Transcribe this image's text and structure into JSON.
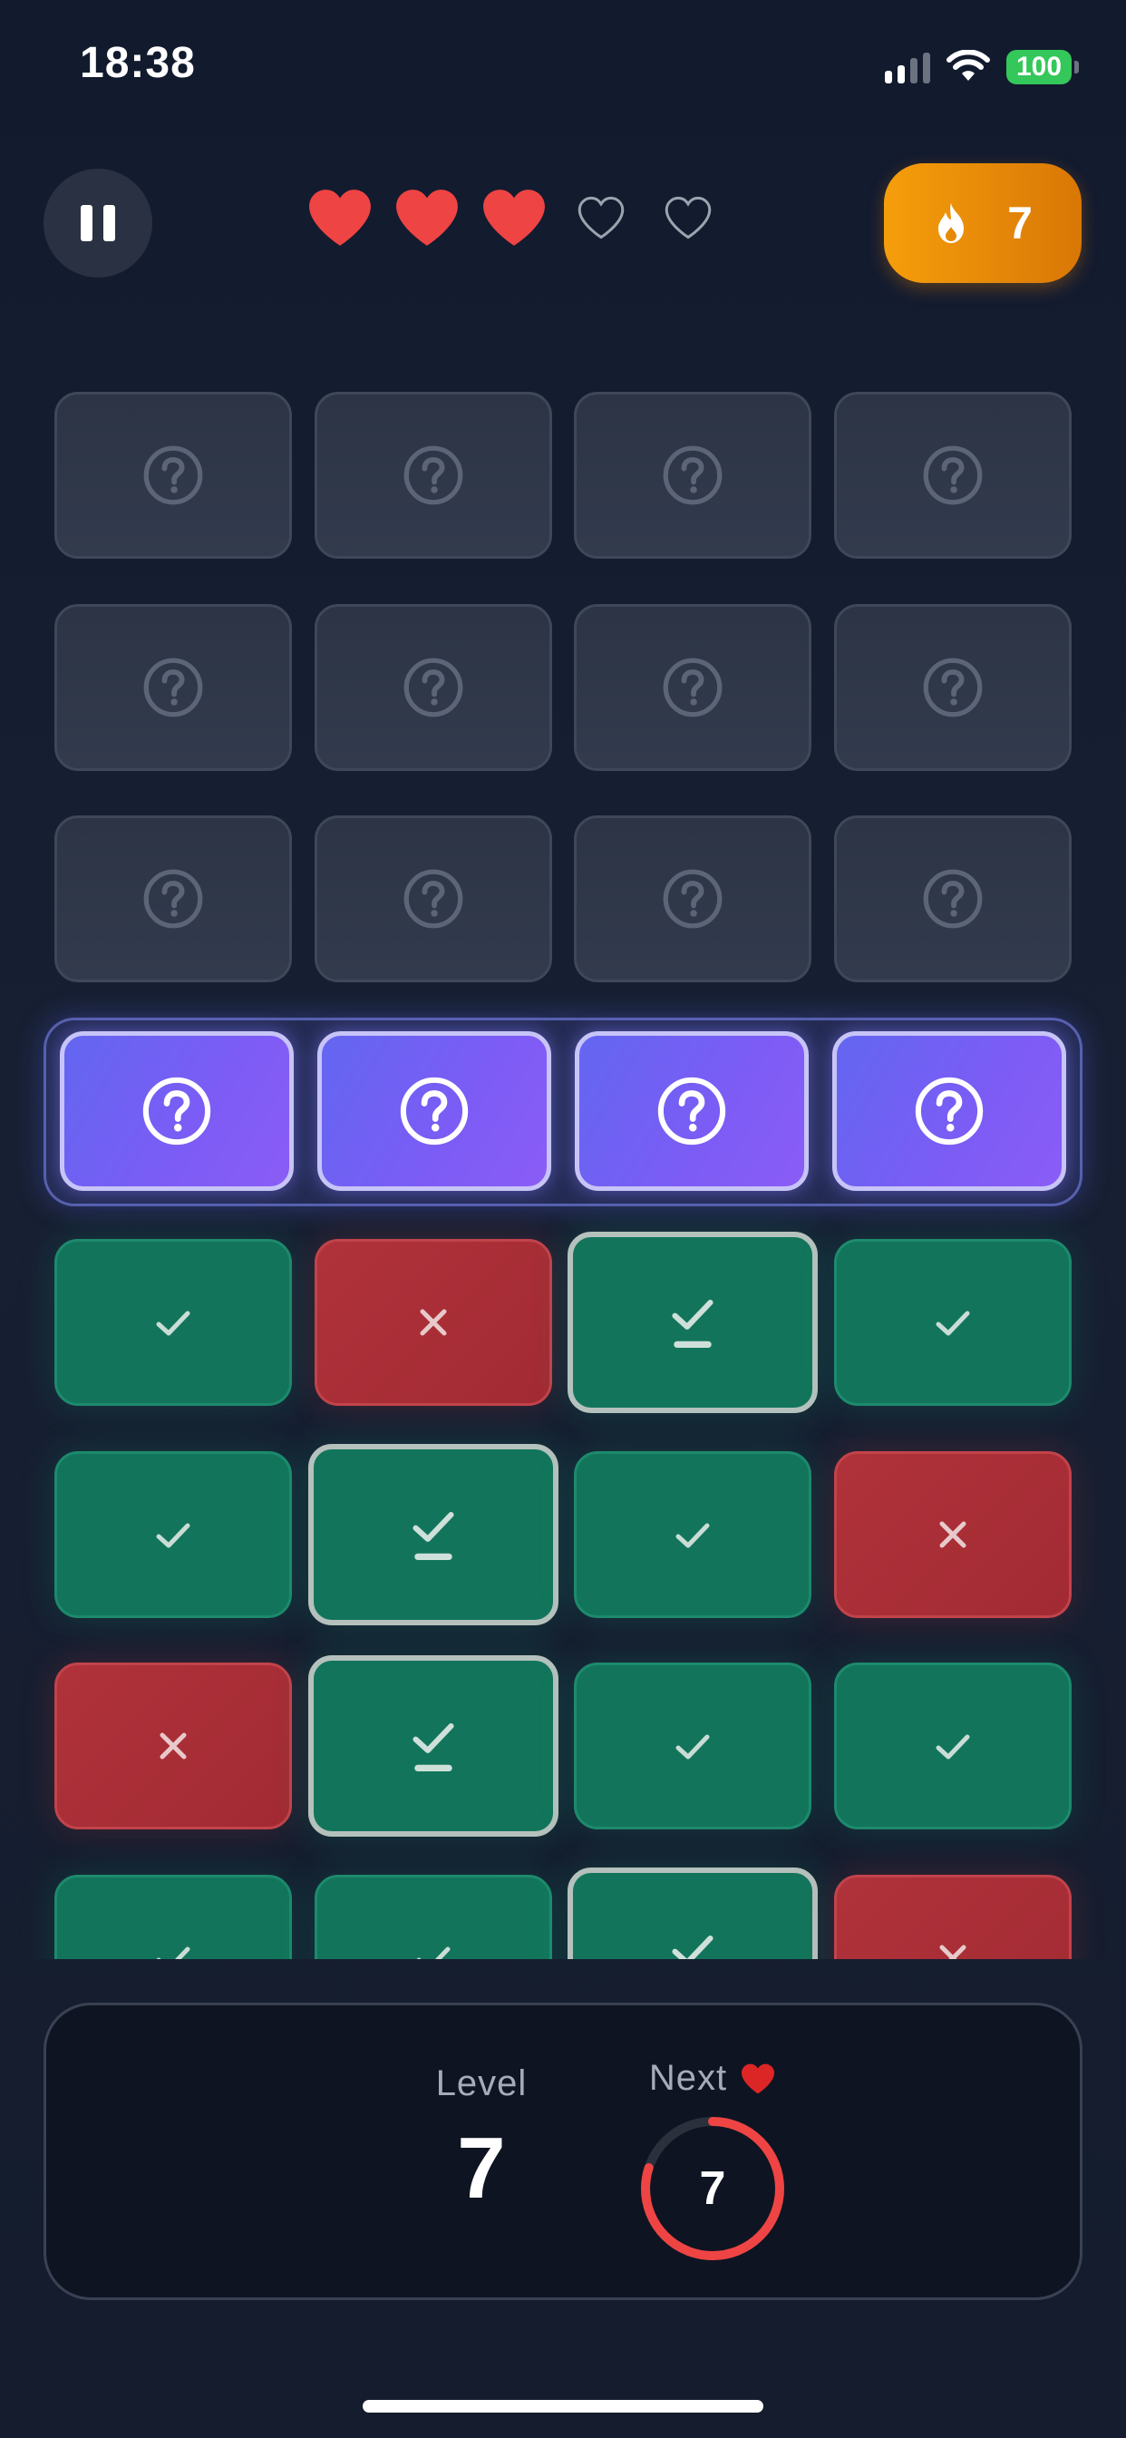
{
  "status_bar": {
    "time": "18:38",
    "battery": "100"
  },
  "top_bar": {
    "lives": {
      "filled": 3,
      "total": 5
    },
    "streak_count": "7"
  },
  "grid": {
    "rows": [
      [
        "unknown",
        "unknown",
        "unknown",
        "unknown"
      ],
      [
        "unknown",
        "unknown",
        "unknown",
        "unknown"
      ],
      [
        "unknown",
        "unknown",
        "unknown",
        "unknown"
      ],
      [
        "active",
        "active",
        "active",
        "active"
      ],
      [
        "correct",
        "wrong",
        "selected",
        "correct"
      ],
      [
        "correct",
        "selected",
        "correct",
        "wrong"
      ],
      [
        "wrong",
        "selected",
        "correct",
        "correct"
      ],
      [
        "correct",
        "correct",
        "selected",
        "wrong"
      ]
    ]
  },
  "bottom_panel": {
    "level_label": "Level",
    "level_value": "7",
    "next_label": "Next",
    "next_value": "7",
    "next_progress": 0.8
  },
  "colors": {
    "accent_active": "#6366f1",
    "correct": "#12755b",
    "wrong": "#b0323a",
    "heart": "#ef4444",
    "streak": "#f59e0b"
  }
}
